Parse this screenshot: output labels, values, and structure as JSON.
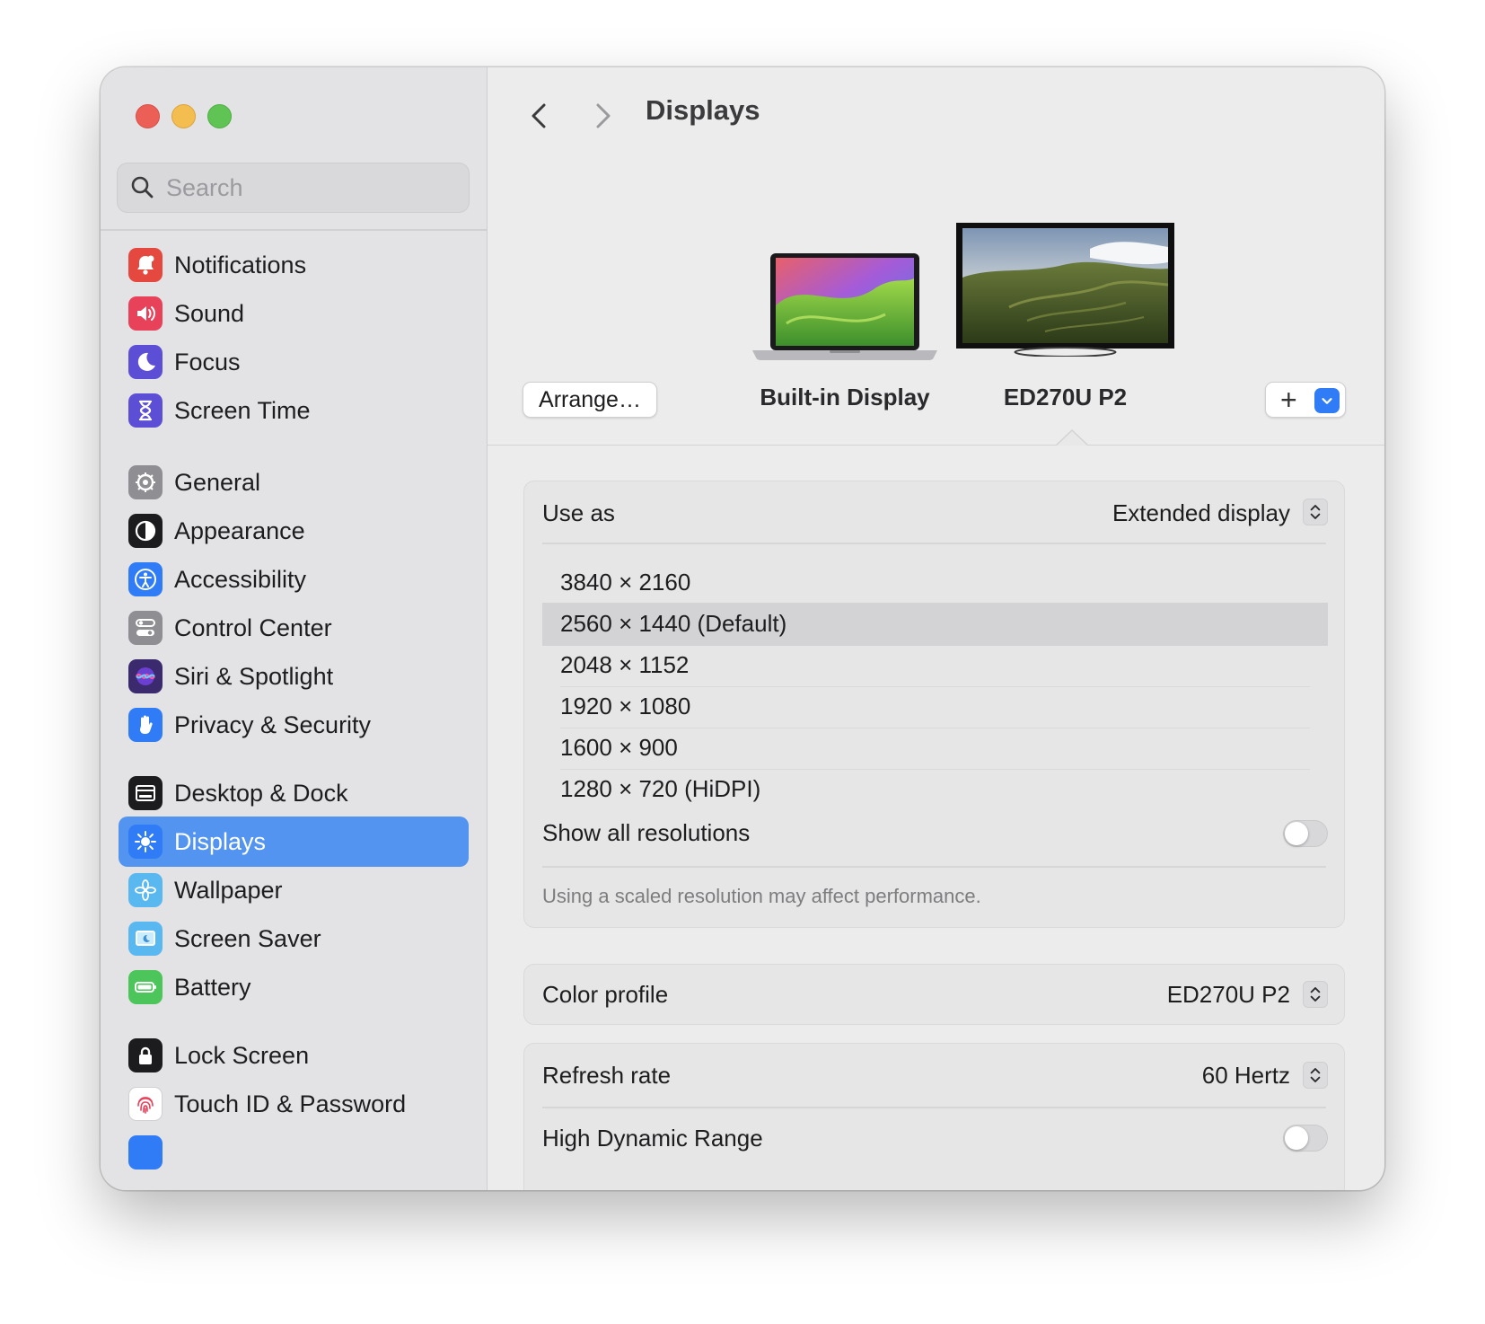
{
  "window": {
    "title": "Displays"
  },
  "search": {
    "placeholder": "Search"
  },
  "sidebar": {
    "items": [
      {
        "label": "Notifications",
        "icon": "bell-icon",
        "color": "#e5483f"
      },
      {
        "label": "Sound",
        "icon": "speaker-icon",
        "color": "#e8415a"
      },
      {
        "label": "Focus",
        "icon": "moon-icon",
        "color": "#5c4fd6"
      },
      {
        "label": "Screen Time",
        "icon": "hourglass-icon",
        "color": "#5c4fd6"
      },
      {
        "label": "General",
        "icon": "gear-icon",
        "color": "#8e8e93"
      },
      {
        "label": "Appearance",
        "icon": "appearance-icon",
        "color": "#1c1c1e"
      },
      {
        "label": "Accessibility",
        "icon": "accessibility-icon",
        "color": "#2f7cf6"
      },
      {
        "label": "Control Center",
        "icon": "toggles-icon",
        "color": "#8e8e93"
      },
      {
        "label": "Siri & Spotlight",
        "icon": "siri-icon",
        "color": "#3b2a6e"
      },
      {
        "label": "Privacy & Security",
        "icon": "hand-icon",
        "color": "#2f7cf6"
      },
      {
        "label": "Desktop & Dock",
        "icon": "dock-icon",
        "color": "#1c1c1e"
      },
      {
        "label": "Displays",
        "icon": "sun-icon",
        "color": "#2f7cf6",
        "active": true
      },
      {
        "label": "Wallpaper",
        "icon": "flower-icon",
        "color": "#5ab8f0"
      },
      {
        "label": "Screen Saver",
        "icon": "screensaver-icon",
        "color": "#5ab8f0"
      },
      {
        "label": "Battery",
        "icon": "battery-icon",
        "color": "#4cc55a"
      },
      {
        "label": "Lock Screen",
        "icon": "lock-icon",
        "color": "#1c1c1e"
      },
      {
        "label": "Touch ID & Password",
        "icon": "fingerprint-icon",
        "color": "#ffffff"
      }
    ]
  },
  "displays": {
    "arrange_label": "Arrange…",
    "builtin_label": "Built-in Display",
    "external_label": "ED270U P2",
    "add_label": "+"
  },
  "use_as": {
    "label": "Use as",
    "value": "Extended display"
  },
  "resolutions": {
    "options": [
      "3840 × 2160",
      "2560 × 1440 (Default)",
      "2048 × 1152",
      "1920 × 1080",
      "1600 × 900",
      "1280 × 720 (HiDPI)"
    ],
    "selected_index": 1,
    "show_all_label": "Show all resolutions",
    "show_all_on": false,
    "note": "Using a scaled resolution may affect performance."
  },
  "color_profile": {
    "label": "Color profile",
    "value": "ED270U P2"
  },
  "refresh_rate": {
    "label": "Refresh rate",
    "value": "60 Hertz"
  },
  "hdr": {
    "label": "High Dynamic Range",
    "on": false
  }
}
